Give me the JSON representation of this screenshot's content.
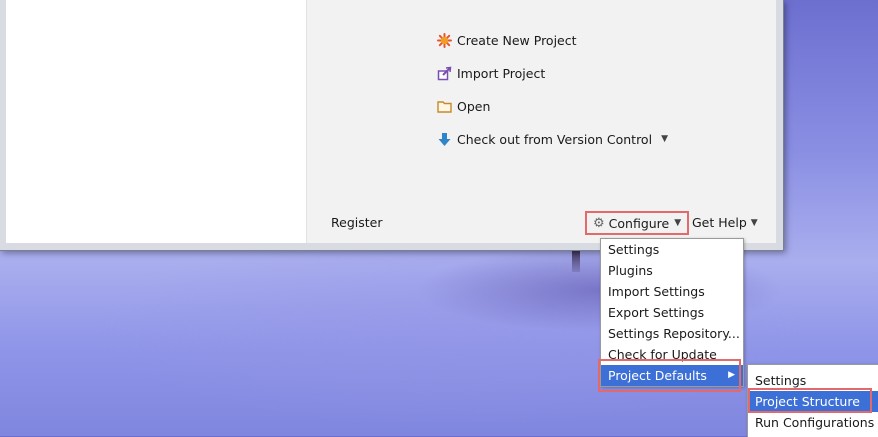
{
  "welcome": {
    "actions": [
      {
        "label": "Create New Project",
        "icon": "sun-star-icon"
      },
      {
        "label": "Import Project",
        "icon": "import-icon"
      },
      {
        "label": "Open",
        "icon": "folder-icon"
      },
      {
        "label": "Check out from Version Control",
        "icon": "down-arrow-icon"
      }
    ],
    "register_label": "Register",
    "configure_label": "Configure",
    "get_help_label": "Get Help"
  },
  "configure_menu": {
    "items": [
      "Settings",
      "Plugins",
      "Import Settings",
      "Export Settings",
      "Settings Repository...",
      "Check for Update",
      "Project Defaults"
    ],
    "selected": "Project Defaults"
  },
  "project_defaults_submenu": {
    "items": [
      "Settings",
      "Project Structure",
      "Run Configurations"
    ],
    "selected": "Project Structure"
  },
  "colors": {
    "selection": "#3d70d6",
    "highlight_box": "#e36a6a",
    "gear": "#666666",
    "create_icon": "#e8542a",
    "folder_icon": "#c58a2e",
    "arrow_icon": "#2e86c8"
  }
}
